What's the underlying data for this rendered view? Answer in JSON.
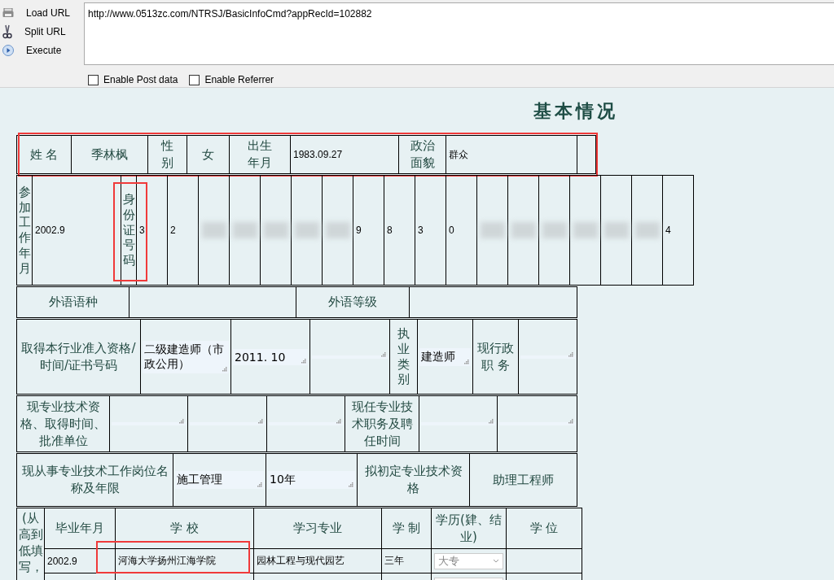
{
  "toolbar": {
    "buttons": [
      {
        "kind": "load",
        "label": "Load URL"
      },
      {
        "kind": "split",
        "label": "Split URL"
      },
      {
        "kind": "execute",
        "label": "Execute"
      }
    ],
    "url": "http://www.0513zc.com/NTRSJ/BasicInfoCmd?appRecId=102882",
    "options": [
      {
        "label": "Enable Post data",
        "checked": false
      },
      {
        "label": "Enable Referrer",
        "checked": false
      }
    ]
  },
  "title": "基本情况",
  "tables": [
    {
      "highlighted": true,
      "rows": [
        [
          {
            "kind": "label",
            "text": "姓 名"
          },
          {
            "kind": "label",
            "text": "季林枫"
          },
          {
            "kind": "label",
            "text": "性别"
          },
          {
            "kind": "label",
            "text": "女"
          },
          {
            "kind": "label",
            "text": "出生年月"
          },
          {
            "kind": "value",
            "text": "1983.09.27"
          },
          {
            "kind": "label",
            "text": "政治面貌"
          },
          {
            "kind": "value",
            "text": "群众"
          },
          {
            "kind": "blank"
          }
        ]
      ]
    },
    {
      "rows": [
        [
          {
            "kind": "vlabel",
            "text": "参加工作年月"
          },
          {
            "kind": "value",
            "text": "2002.9"
          },
          {
            "kind": "vlabel",
            "text": "身份证号码",
            "highlighted": true
          },
          {
            "kind": "digit",
            "text": "3"
          },
          {
            "kind": "digit",
            "text": "2"
          },
          {
            "kind": "redacted"
          },
          {
            "kind": "redacted"
          },
          {
            "kind": "redacted"
          },
          {
            "kind": "redacted"
          },
          {
            "kind": "redacted"
          },
          {
            "kind": "digit",
            "text": "9"
          },
          {
            "kind": "digit",
            "text": "8"
          },
          {
            "kind": "digit",
            "text": "3"
          },
          {
            "kind": "digit",
            "text": "0"
          },
          {
            "kind": "redacted"
          },
          {
            "kind": "redacted"
          },
          {
            "kind": "redacted"
          },
          {
            "kind": "redacted"
          },
          {
            "kind": "redacted"
          },
          {
            "kind": "redacted"
          },
          {
            "kind": "digit",
            "text": "4"
          }
        ]
      ]
    },
    {
      "rows": [
        [
          {
            "kind": "label",
            "text": "外语语种"
          },
          {
            "kind": "blank"
          },
          {
            "kind": "label",
            "text": "外语等级"
          },
          {
            "kind": "blank"
          }
        ]
      ]
    },
    {
      "rows": [
        [
          {
            "kind": "label",
            "text": "取得本行业准入资格/时间/证书号码"
          },
          {
            "kind": "field",
            "text": "二级建造师（市政公用）"
          },
          {
            "kind": "field",
            "text": "2011. 10"
          },
          {
            "kind": "field"
          },
          {
            "kind": "vlabel",
            "text": "执业类别"
          },
          {
            "kind": "field",
            "text": "建造师"
          },
          {
            "kind": "label",
            "text": "现行政职 务"
          },
          {
            "kind": "field"
          }
        ]
      ]
    },
    {
      "rows": [
        [
          {
            "kind": "label",
            "text": "现专业技术资格、取得时间、批准单位"
          },
          {
            "kind": "field"
          },
          {
            "kind": "field"
          },
          {
            "kind": "field"
          },
          {
            "kind": "label",
            "text": "现任专业技术职务及聘任时间"
          },
          {
            "kind": "field"
          },
          {
            "kind": "field"
          }
        ]
      ]
    },
    {
      "rows": [
        [
          {
            "kind": "label",
            "text": "现从事专业技术工作岗位名称及年限"
          },
          {
            "kind": "field",
            "text": "施工管理"
          },
          {
            "kind": "field",
            "text": "10年"
          },
          {
            "kind": "label",
            "text": "拟初定专业技术资格"
          },
          {
            "kind": "label",
            "text": "助理工程师"
          }
        ]
      ]
    }
  ],
  "education": {
    "side_label": "(从高到低填写，",
    "columns": [
      "毕业年月",
      "学 校",
      "学习专业",
      "学 制",
      "学历(肄、结业)",
      "学 位"
    ],
    "rows": [
      [
        {
          "kind": "value",
          "text": "2002.9"
        },
        {
          "kind": "value",
          "text": "河海大学扬州江海学院",
          "highlighted": true
        },
        {
          "kind": "value",
          "text": "园林工程与现代园艺"
        },
        {
          "kind": "value",
          "text": "三年"
        },
        {
          "kind": "select",
          "text": "大专"
        },
        {
          "kind": "blank"
        }
      ],
      [
        {
          "kind": "blank"
        },
        {
          "kind": "blank"
        },
        {
          "kind": "blank"
        },
        {
          "kind": "blank"
        },
        {
          "kind": "select"
        },
        {
          "kind": "blank"
        }
      ]
    ]
  }
}
